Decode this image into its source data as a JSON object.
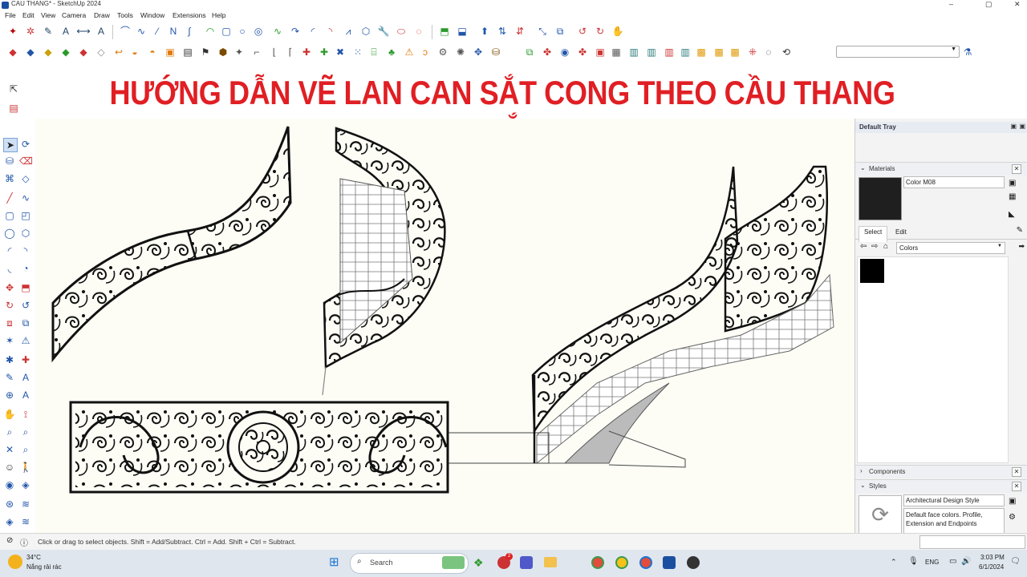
{
  "app": {
    "title": "CAU THANG* - SketchUp 2024",
    "accent": "#1a4fa0"
  },
  "menu": [
    "File",
    "Edit",
    "View",
    "Camera",
    "Draw",
    "Tools",
    "Window",
    "Extensions",
    "Help"
  ],
  "banner": {
    "text": "HƯỚNG DẪN VẼ LAN CAN SẮT CONG THEO CẦU THANG XOẮN",
    "color": "#e01f24"
  },
  "search": {
    "value": ""
  },
  "tray": {
    "title": "Default Tray",
    "materials": {
      "label": "Materials",
      "name": "Color M08",
      "swatch": "#1f1f1f",
      "tabs": [
        "Select",
        "Edit"
      ],
      "dropdown": "Colors",
      "selected_swatch": "#000000"
    },
    "components": {
      "label": "Components"
    },
    "styles": {
      "label": "Styles",
      "name": "Architectural Design Style",
      "desc": "Default face colors. Profile, Extension and Endpoints"
    }
  },
  "status": {
    "hint": "Click or drag to select objects. Shift = Add/Subtract. Ctrl = Add. Shift + Ctrl = Subtract."
  },
  "taskbar": {
    "weather_temp": "34°C",
    "weather_desc": "Nắng rải rác",
    "search_placeholder": "Search",
    "notif_count": "2",
    "lang": "ENG",
    "time": "3:03 PM",
    "date": "6/1/2024"
  }
}
